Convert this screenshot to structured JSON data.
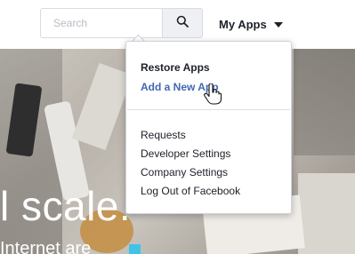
{
  "header": {
    "search": {
      "placeholder": "Search",
      "value": ""
    },
    "search_icon": "magnifier-icon",
    "my_apps_label": "My Apps",
    "my_apps_icon": "caret-down-icon"
  },
  "dropdown": {
    "restore_apps": "Restore Apps",
    "add_new_app": "Add a New App",
    "items": [
      "Requests",
      "Developer Settings",
      "Company Settings",
      "Log Out of Facebook"
    ]
  },
  "hero": {
    "headline": "l scale.",
    "subline": "Internet are"
  },
  "colors": {
    "link": "#4267b2",
    "text": "#1d2129",
    "accent_block": "#3fc3e6"
  }
}
